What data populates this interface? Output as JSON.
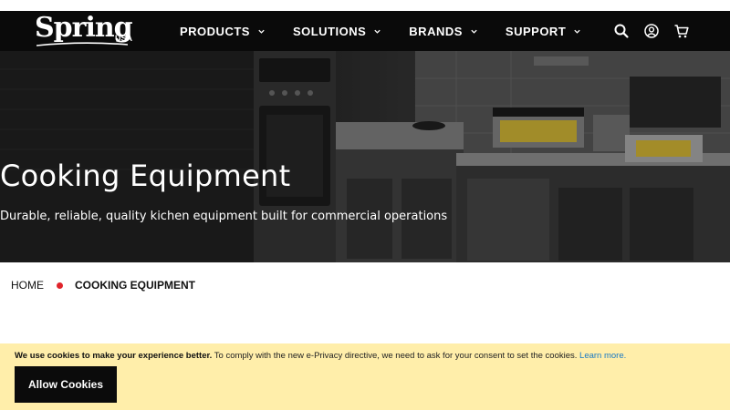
{
  "brand": {
    "name": "Spring",
    "suffix": "USA"
  },
  "nav": {
    "items": [
      {
        "label": "PRODUCTS"
      },
      {
        "label": "SOLUTIONS"
      },
      {
        "label": "BRANDS"
      },
      {
        "label": "SUPPORT"
      }
    ],
    "icons": [
      "search-icon",
      "account-icon",
      "cart-icon"
    ]
  },
  "hero": {
    "title": "Cooking Equipment",
    "subtitle": "Durable, reliable, quality kichen equipment built for commercial operations"
  },
  "breadcrumb": {
    "home": "HOME",
    "current": "COOKING EQUIPMENT",
    "separator_color": "#e0242b"
  },
  "cookie": {
    "bold_text": "We use cookies to make your experience better.",
    "text": " To comply with the new e-Privacy directive, we need to ask for your consent to set the cookies. ",
    "link": "Learn more.",
    "button": "Allow Cookies",
    "background": "#ffeeaa"
  },
  "colors": {
    "header": "#0a0a0a",
    "accent": "#e0242b",
    "link": "#1979c3"
  }
}
